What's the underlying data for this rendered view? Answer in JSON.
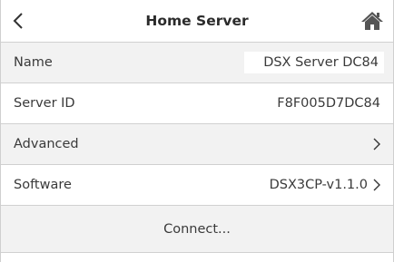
{
  "header": {
    "title": "Home Server",
    "back_icon": "chevron-left-icon",
    "home_icon": "home-icon"
  },
  "rows": [
    {
      "label": "Name",
      "value": "DSX Server DC84"
    },
    {
      "label": "Server ID",
      "value": "F8F005D7DC84"
    },
    {
      "label": "Advanced",
      "value": ""
    },
    {
      "label": "Software",
      "value": "DSX3CP-v1.1.0"
    }
  ],
  "connect": {
    "label": "Connect..."
  },
  "colors": {
    "row_shade": "#f2f2f2",
    "divider": "#d0d0d0",
    "text": "#3a3a3a"
  }
}
